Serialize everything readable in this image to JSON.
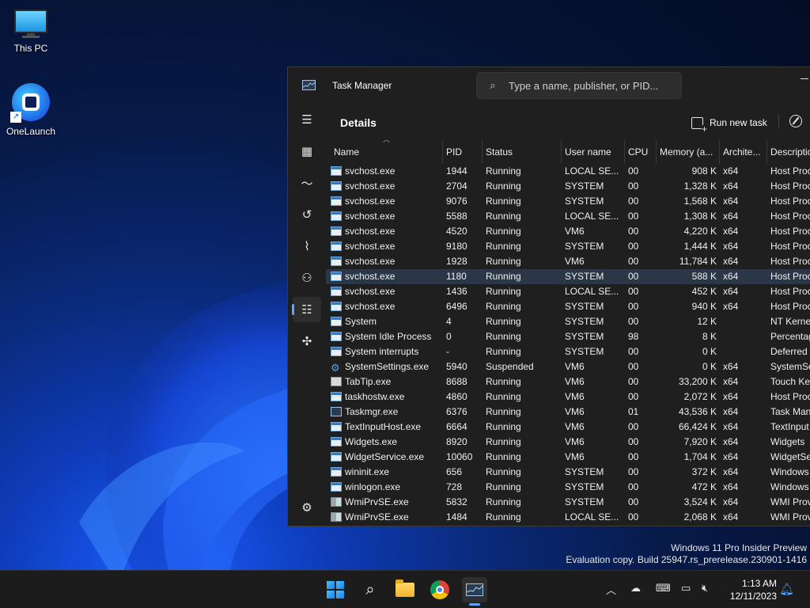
{
  "desktop": {
    "icons": [
      {
        "label": "This PC",
        "icon": "monitor-icon"
      },
      {
        "label": "OneLaunch",
        "icon": "onelaunch-icon"
      }
    ],
    "watermark_line1": "Windows 11 Pro Insider Preview",
    "watermark_line2": "Evaluation copy. Build 25947.rs_prerelease.230901-1416"
  },
  "window": {
    "title": "Task Manager",
    "search_placeholder": "Type a name, publisher, or PID...",
    "page_title": "Details",
    "run_new_task_label": "Run new task"
  },
  "nav": [
    "menu-icon",
    "processes-icon",
    "performance-icon",
    "app-history-icon",
    "startup-apps-icon",
    "users-icon",
    "details-icon",
    "services-icon",
    "settings-icon"
  ],
  "columns": [
    "Name",
    "PID",
    "Status",
    "User name",
    "CPU",
    "Memory (a...",
    "Archite...",
    "Descriptio"
  ],
  "rows": [
    {
      "name": "svchost.exe",
      "icon": "svc",
      "pid": "1944",
      "status": "Running",
      "user": "LOCAL SE...",
      "cpu": "00",
      "mem": "908 K",
      "arch": "x64",
      "desc": "Host Proc"
    },
    {
      "name": "svchost.exe",
      "icon": "svc",
      "pid": "2704",
      "status": "Running",
      "user": "SYSTEM",
      "cpu": "00",
      "mem": "1,328 K",
      "arch": "x64",
      "desc": "Host Proc"
    },
    {
      "name": "svchost.exe",
      "icon": "svc",
      "pid": "9076",
      "status": "Running",
      "user": "SYSTEM",
      "cpu": "00",
      "mem": "1,568 K",
      "arch": "x64",
      "desc": "Host Proc"
    },
    {
      "name": "svchost.exe",
      "icon": "svc",
      "pid": "5588",
      "status": "Running",
      "user": "LOCAL SE...",
      "cpu": "00",
      "mem": "1,308 K",
      "arch": "x64",
      "desc": "Host Proc"
    },
    {
      "name": "svchost.exe",
      "icon": "svc",
      "pid": "4520",
      "status": "Running",
      "user": "VM6",
      "cpu": "00",
      "mem": "4,220 K",
      "arch": "x64",
      "desc": "Host Proc"
    },
    {
      "name": "svchost.exe",
      "icon": "svc",
      "pid": "9180",
      "status": "Running",
      "user": "SYSTEM",
      "cpu": "00",
      "mem": "1,444 K",
      "arch": "x64",
      "desc": "Host Proc"
    },
    {
      "name": "svchost.exe",
      "icon": "svc",
      "pid": "1928",
      "status": "Running",
      "user": "VM6",
      "cpu": "00",
      "mem": "11,784 K",
      "arch": "x64",
      "desc": "Host Proc"
    },
    {
      "name": "svchost.exe",
      "icon": "svc",
      "pid": "1180",
      "status": "Running",
      "user": "SYSTEM",
      "cpu": "00",
      "mem": "588 K",
      "arch": "x64",
      "desc": "Host Proc",
      "selected": true
    },
    {
      "name": "svchost.exe",
      "icon": "svc",
      "pid": "1436",
      "status": "Running",
      "user": "LOCAL SE...",
      "cpu": "00",
      "mem": "452 K",
      "arch": "x64",
      "desc": "Host Proc"
    },
    {
      "name": "svchost.exe",
      "icon": "svc",
      "pid": "6496",
      "status": "Running",
      "user": "SYSTEM",
      "cpu": "00",
      "mem": "940 K",
      "arch": "x64",
      "desc": "Host Proc"
    },
    {
      "name": "System",
      "icon": "svc",
      "pid": "4",
      "status": "Running",
      "user": "SYSTEM",
      "cpu": "00",
      "mem": "12 K",
      "arch": "",
      "desc": "NT Kerne"
    },
    {
      "name": "System Idle Process",
      "icon": "svc",
      "pid": "0",
      "status": "Running",
      "user": "SYSTEM",
      "cpu": "98",
      "mem": "8 K",
      "arch": "",
      "desc": "Percentag"
    },
    {
      "name": "System interrupts",
      "icon": "svc",
      "pid": "-",
      "status": "Running",
      "user": "SYSTEM",
      "cpu": "00",
      "mem": "0 K",
      "arch": "",
      "desc": "Deferred"
    },
    {
      "name": "SystemSettings.exe",
      "icon": "gear",
      "pid": "5940",
      "status": "Suspended",
      "user": "VM6",
      "cpu": "00",
      "mem": "0 K",
      "arch": "x64",
      "desc": "SystemSe"
    },
    {
      "name": "TabTip.exe",
      "icon": "kbd",
      "pid": "8688",
      "status": "Running",
      "user": "VM6",
      "cpu": "00",
      "mem": "33,200 K",
      "arch": "x64",
      "desc": "Touch Ke"
    },
    {
      "name": "taskhostw.exe",
      "icon": "svc",
      "pid": "4860",
      "status": "Running",
      "user": "VM6",
      "cpu": "00",
      "mem": "2,072 K",
      "arch": "x64",
      "desc": "Host Proc"
    },
    {
      "name": "Taskmgr.exe",
      "icon": "tm",
      "pid": "6376",
      "status": "Running",
      "user": "VM6",
      "cpu": "01",
      "mem": "43,536 K",
      "arch": "x64",
      "desc": "Task Man"
    },
    {
      "name": "TextInputHost.exe",
      "icon": "svc",
      "pid": "6664",
      "status": "Running",
      "user": "VM6",
      "cpu": "00",
      "mem": "66,424 K",
      "arch": "x64",
      "desc": "TextInput"
    },
    {
      "name": "Widgets.exe",
      "icon": "svc",
      "pid": "8920",
      "status": "Running",
      "user": "VM6",
      "cpu": "00",
      "mem": "7,920 K",
      "arch": "x64",
      "desc": "Widgets"
    },
    {
      "name": "WidgetService.exe",
      "icon": "svc",
      "pid": "10060",
      "status": "Running",
      "user": "VM6",
      "cpu": "00",
      "mem": "1,704 K",
      "arch": "x64",
      "desc": "WidgetSe"
    },
    {
      "name": "wininit.exe",
      "icon": "svc",
      "pid": "656",
      "status": "Running",
      "user": "SYSTEM",
      "cpu": "00",
      "mem": "372 K",
      "arch": "x64",
      "desc": "Windows"
    },
    {
      "name": "winlogon.exe",
      "icon": "svc",
      "pid": "728",
      "status": "Running",
      "user": "SYSTEM",
      "cpu": "00",
      "mem": "472 K",
      "arch": "x64",
      "desc": "Windows"
    },
    {
      "name": "WmiPrvSE.exe",
      "icon": "wmi",
      "pid": "5832",
      "status": "Running",
      "user": "SYSTEM",
      "cpu": "00",
      "mem": "3,524 K",
      "arch": "x64",
      "desc": "WMI Prov"
    },
    {
      "name": "WmiPrvSE.exe",
      "icon": "wmi",
      "pid": "1484",
      "status": "Running",
      "user": "LOCAL SE...",
      "cpu": "00",
      "mem": "2,068 K",
      "arch": "x64",
      "desc": "WMI Prov"
    }
  ],
  "taskbar": {
    "items": [
      "start-icon",
      "search-icon",
      "file-explorer-icon",
      "chrome-icon",
      "task-manager-icon"
    ],
    "tray": [
      "chevron-up-icon",
      "network-off-icon",
      "keyboard-icon",
      "display-icon",
      "volume-muted-icon"
    ],
    "time": "1:13 AM",
    "date": "12/11/2023"
  },
  "colors": {
    "accent": "#60a8ff",
    "selected_row": "#2b3747",
    "window_bg": "#1f1f1f"
  }
}
